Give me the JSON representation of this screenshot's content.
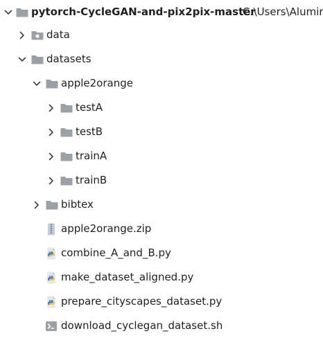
{
  "project": {
    "name": "pytorch-CycleGAN-and-pix2pix-master",
    "path": "C:\\Users\\Alumin"
  },
  "tree": {
    "data": "data",
    "datasets": "datasets",
    "apple2orange": "apple2orange",
    "testA": "testA",
    "testB": "testB",
    "trainA": "trainA",
    "trainB": "trainB",
    "bibtex": "bibtex",
    "zip_file": "apple2orange.zip",
    "combine_file": "combine_A_and_B.py",
    "make_file": "make_dataset_aligned.py",
    "prepare_file": "prepare_cityscapes_dataset.py",
    "download_file": "download_cyclegan_dataset.sh"
  },
  "colors": {
    "folder": "#9aa0a6",
    "chevron": "#3c3f44",
    "python_blue": "#4a7fb5",
    "python_yellow": "#f2c94c",
    "text": "#1e1f22"
  },
  "icons": {
    "expanded": "chevron-down-icon",
    "collapsed": "chevron-right-icon",
    "folder": "folder-icon",
    "module_folder": "module-folder-icon",
    "archive": "zip-archive-icon",
    "python": "python-file-icon",
    "shell": "shell-script-icon"
  }
}
